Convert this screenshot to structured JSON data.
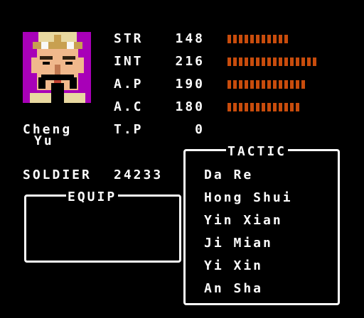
{
  "general": {
    "name_line1": "Cheng",
    "name_line2": "Yu",
    "portrait_icon": "general-portrait"
  },
  "stats": [
    {
      "label": "STR",
      "value": "148",
      "bar": 0.54
    },
    {
      "label": "INT",
      "value": "216",
      "bar": 0.79
    },
    {
      "label": "A.P",
      "value": "190",
      "bar": 0.69
    },
    {
      "label": "A.C",
      "value": "180",
      "bar": 0.65
    },
    {
      "label": "T.P",
      "value": "0",
      "bar": 0
    }
  ],
  "soldier": {
    "label": "SOLDIER",
    "value": "24233"
  },
  "equip": {
    "title": "EQUIP"
  },
  "tactic": {
    "title": "TACTIC",
    "items": [
      "Da Re",
      "Hong Shui",
      "Yin Xian",
      "Ji Mian",
      "Yi Xin",
      "An Sha"
    ]
  },
  "colors": {
    "bar": "#c84c0c",
    "portrait_bg": "#a800b8",
    "text": "#fcfcfc"
  }
}
